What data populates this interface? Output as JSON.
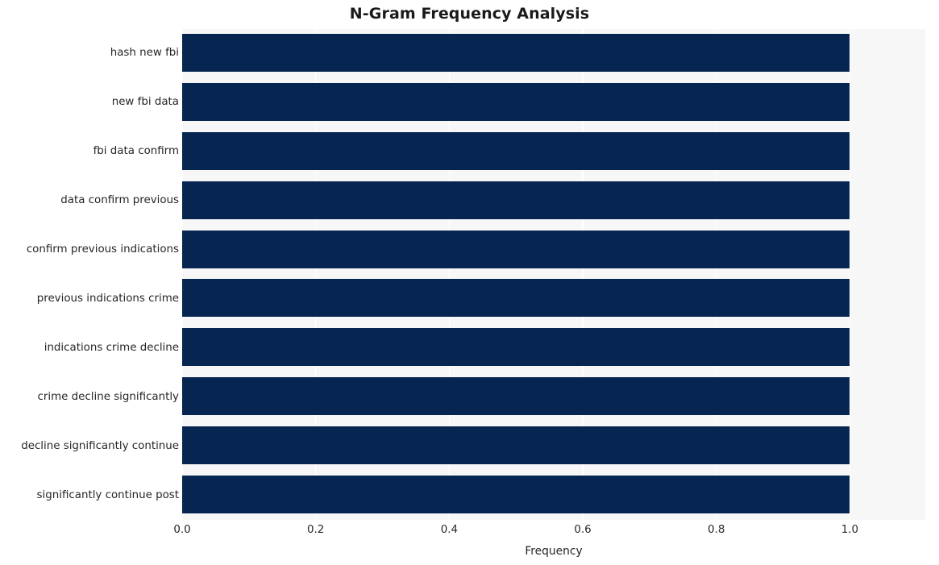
{
  "chart_data": {
    "type": "bar",
    "orientation": "horizontal",
    "title": "N-Gram Frequency Analysis",
    "xlabel": "Frequency",
    "ylabel": "",
    "categories": [
      "hash new fbi",
      "new fbi data",
      "fbi data confirm",
      "data confirm previous",
      "confirm previous indications",
      "previous indications crime",
      "indications crime decline",
      "crime decline significantly",
      "decline significantly continue",
      "significantly continue post"
    ],
    "values": [
      1.0,
      1.0,
      1.0,
      1.0,
      1.0,
      1.0,
      1.0,
      1.0,
      1.0,
      1.0
    ],
    "xlim": [
      0.0,
      1.113
    ],
    "xticks": [
      0.0,
      0.2,
      0.4,
      0.6,
      0.8,
      1.0
    ],
    "xtick_labels": [
      "0.0",
      "0.2",
      "0.4",
      "0.6",
      "0.8",
      "1.0"
    ],
    "grid": true,
    "grid_axis": "x",
    "legend": false,
    "bar_color": "#072551",
    "plot_background": "#f7f7f7",
    "figure_background": "#ffffff",
    "gridline_color": "#ffffff",
    "text_color": "#262626"
  }
}
